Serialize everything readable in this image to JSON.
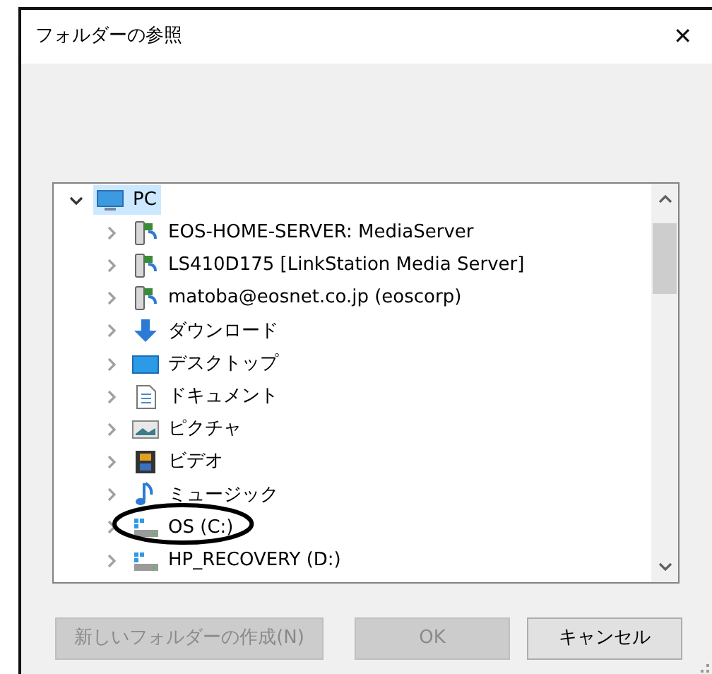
{
  "window": {
    "title": "フォルダーの参照",
    "close": "✕"
  },
  "tree": [
    {
      "label": "PC",
      "kind": "pc",
      "selected": true,
      "expanded": true,
      "children": [
        {
          "label": "EOS-HOME-SERVER: MediaServer",
          "kind": "network",
          "selected": false,
          "expanded": false
        },
        {
          "label": "LS410D175 [LinkStation Media Server]",
          "kind": "network",
          "selected": false,
          "expanded": false
        },
        {
          "label": "matoba@eosnet.co.jp (eoscorp)",
          "kind": "network",
          "selected": false,
          "expanded": false
        },
        {
          "label": "ダウンロード",
          "kind": "download",
          "selected": false,
          "expanded": false
        },
        {
          "label": "デスクトップ",
          "kind": "desktop",
          "selected": false,
          "expanded": false
        },
        {
          "label": "ドキュメント",
          "kind": "documents",
          "selected": false,
          "expanded": false
        },
        {
          "label": "ピクチャ",
          "kind": "pictures",
          "selected": false,
          "expanded": false
        },
        {
          "label": "ビデオ",
          "kind": "videos",
          "selected": false,
          "expanded": false
        },
        {
          "label": "ミュージック",
          "kind": "music",
          "selected": false,
          "expanded": false
        },
        {
          "label": "OS (C:)",
          "kind": "drive",
          "selected": false,
          "expanded": false,
          "circled": true
        },
        {
          "label": "HP_RECOVERY (D:)",
          "kind": "drive",
          "selected": false,
          "expanded": false
        }
      ]
    }
  ],
  "buttons": [
    {
      "label": "新しいフォルダーの作成(N)",
      "disabled": true
    },
    {
      "label": "OK",
      "disabled": true
    },
    {
      "label": "キャンセル",
      "disabled": false
    }
  ]
}
